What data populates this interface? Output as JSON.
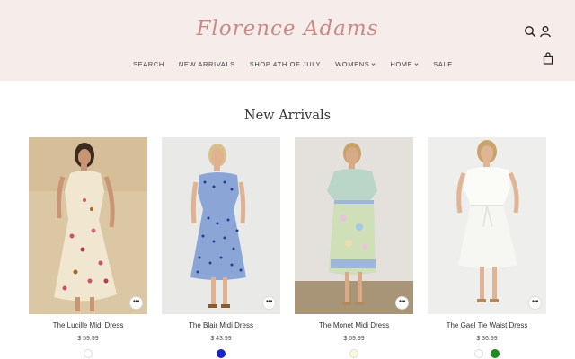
{
  "header": {
    "logo_text": "Florence Adams",
    "nav": [
      {
        "label": "SEARCH",
        "has_dropdown": false
      },
      {
        "label": "NEW ARRIVALS",
        "has_dropdown": false
      },
      {
        "label": "SHOP 4TH OF JULY",
        "has_dropdown": false
      },
      {
        "label": "WOMENS",
        "has_dropdown": true
      },
      {
        "label": "HOME",
        "has_dropdown": true
      },
      {
        "label": "SALE",
        "has_dropdown": false
      }
    ],
    "icons": [
      "search-icon",
      "account-icon",
      "cart-icon"
    ]
  },
  "main": {
    "title": "New Arrivals",
    "products": [
      {
        "name": "The Lucille Midi Dress",
        "price": "$ 59.99",
        "swatches": [
          "#ffffff"
        ]
      },
      {
        "name": "The Blair Midi Dress",
        "price": "$ 43.99",
        "swatches": [
          "#1a22c8"
        ]
      },
      {
        "name": "The Monet Midi Dress",
        "price": "$ 69.99",
        "swatches": [
          "#fbf8dc"
        ]
      },
      {
        "name": "The Gael Tie Waist Dress",
        "price": "$ 36.99",
        "swatches": [
          "#ffffff",
          "#1f8a1f"
        ]
      }
    ]
  },
  "colors": {
    "header_bg": "#f6ecea",
    "logo": "#c98a86"
  }
}
